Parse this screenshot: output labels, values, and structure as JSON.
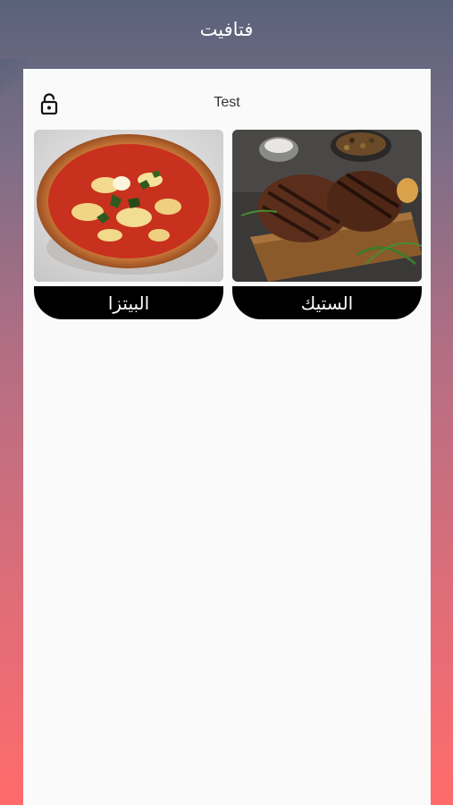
{
  "app": {
    "title": "فتافيت"
  },
  "header": {
    "title": "Test",
    "lock_icon": "lock-open-icon"
  },
  "categories": [
    {
      "label": "البيتزا",
      "image": "pizza-image"
    },
    {
      "label": "الستيك",
      "image": "steak-image"
    }
  ],
  "colors": {
    "gradient_top": "#59627a",
    "gradient_bottom": "#ff6b6b",
    "card_background": "#fafafa",
    "label_background": "#000000",
    "label_text": "#ffffff"
  }
}
